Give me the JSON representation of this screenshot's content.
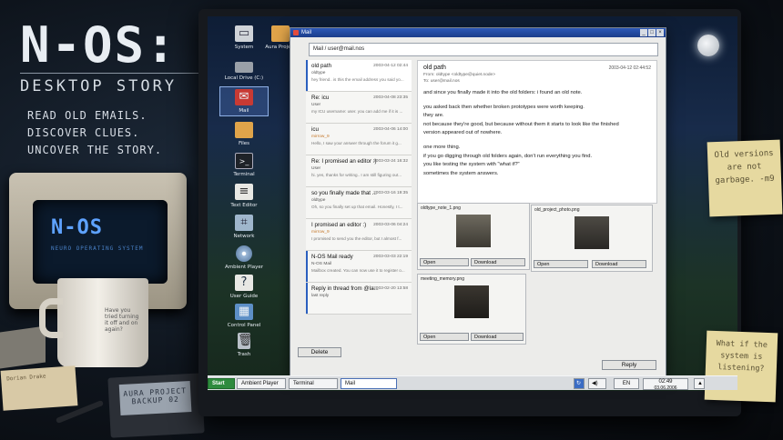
{
  "branding": {
    "logo": "N-OS:",
    "subtitle": "DESKTOP STORY",
    "taglines": [
      "READ OLD EMAILS.",
      "DISCOVER CLUES.",
      "UNCOVER THE STORY."
    ]
  },
  "scene": {
    "crt_title": "N-OS",
    "crt_subtitle": "NEURO OPERATING SYSTEM",
    "mug_text": "Have you tried turning it off and on again?",
    "floppy_label": "AURA PROJECT BACKUP 02",
    "card_text": "Dorian Drake"
  },
  "desktop_icons": [
    {
      "label": "System",
      "icon": "computer-icon"
    },
    {
      "label": "Aura Project",
      "icon": "folder-icon"
    },
    {
      "label": "Local Drive (C:)",
      "icon": "drive-icon"
    },
    {
      "label": "Mail",
      "icon": "mail-icon"
    },
    {
      "label": "Files",
      "icon": "folder-icon"
    },
    {
      "label": "Terminal",
      "icon": "terminal-icon"
    },
    {
      "label": "Text Editor",
      "icon": "text-editor-icon"
    },
    {
      "label": "Network",
      "icon": "network-icon"
    },
    {
      "label": "Ambient Player",
      "icon": "disc-icon"
    },
    {
      "label": "User Guide",
      "icon": "help-icon"
    },
    {
      "label": "Control Panel",
      "icon": "control-panel-icon"
    },
    {
      "label": "Trash",
      "icon": "trash-icon"
    }
  ],
  "notes": {
    "note1": "Old versions are not garbage. -m9",
    "note2": "What if the system is listening?"
  },
  "mail_window": {
    "title": "Mail",
    "address": "Mail / user@mail.nos",
    "messages": [
      {
        "subject": "old path",
        "date": "2003-04-12 02:44",
        "from": "oldtype",
        "preview": "hey friend.. is this the email address you said yo..."
      },
      {
        "subject": "Re: icu",
        "date": "2003-04-08 23:35",
        "from": "User",
        "preview": "my ICU username: user. you can add me if it is ..."
      },
      {
        "subject": "icu",
        "date": "2003-04-06 14:00",
        "from": "mirrow_9",
        "preview": "Hello, I saw your answer through the forum it g..."
      },
      {
        "subject": "Re: I promised an editor :)",
        "date": "2003-03-24 16:32",
        "from": "User",
        "preview": "hi. yes, thanks for writing.. I am still figuring out..."
      },
      {
        "subject": "so you finally made that ...",
        "date": "2003-03-16 19:35",
        "from": "oldtype",
        "preview": "Oh, so you finally set up that email. Honestly, I t..."
      },
      {
        "subject": "I promised an editor :)",
        "date": "2003-03-06 04:24",
        "from": "mirrow_9",
        "preview": "I promised to send you the editor, but I almost f..."
      },
      {
        "subject": "N-OS Mail ready",
        "date": "2003-03-03 22:19",
        "from": "N-OS Mail",
        "preview": "Mailbox created. You can now use it to register o..."
      },
      {
        "subject": "Reply in thread from @la...",
        "date": "2003-02-20 13:58",
        "from": "last reply",
        "preview": ""
      }
    ],
    "delete_label": "Delete",
    "reply_label": "Reply",
    "open": {
      "subject": "old path",
      "date": "2003-04-12 02:44:52",
      "from": "From: oldtype <oldtype@quiet.node>",
      "to": "To: user@mail.nos",
      "body": [
        "and since you finally made it into the old folders: i found an old note.",
        "",
        "you asked back then whether broken prototypes were worth keeping.",
        "they are.",
        "not because they're good, but because without them it starts to look like the finished",
        "version appeared out of nowhere.",
        "",
        "one more thing.",
        "if you go digging through old folders again, don't run everything you find.",
        "you like testing the system with \"what if?\"",
        "sometimes the system answers."
      ]
    },
    "attachments": [
      {
        "name": "oldtype_note_1.png",
        "open": "Open",
        "download": "Download"
      },
      {
        "name": "old_project_photo.png",
        "open": "Open",
        "download": "Download"
      },
      {
        "name": "meeting_memory.png",
        "open": "Open",
        "download": "Download"
      }
    ]
  },
  "taskbar": {
    "start": "Start",
    "items": [
      "Ambient Player",
      "Terminal",
      "Mail"
    ],
    "lang": "EN",
    "time": "02:49",
    "date": "03.06.2006"
  }
}
